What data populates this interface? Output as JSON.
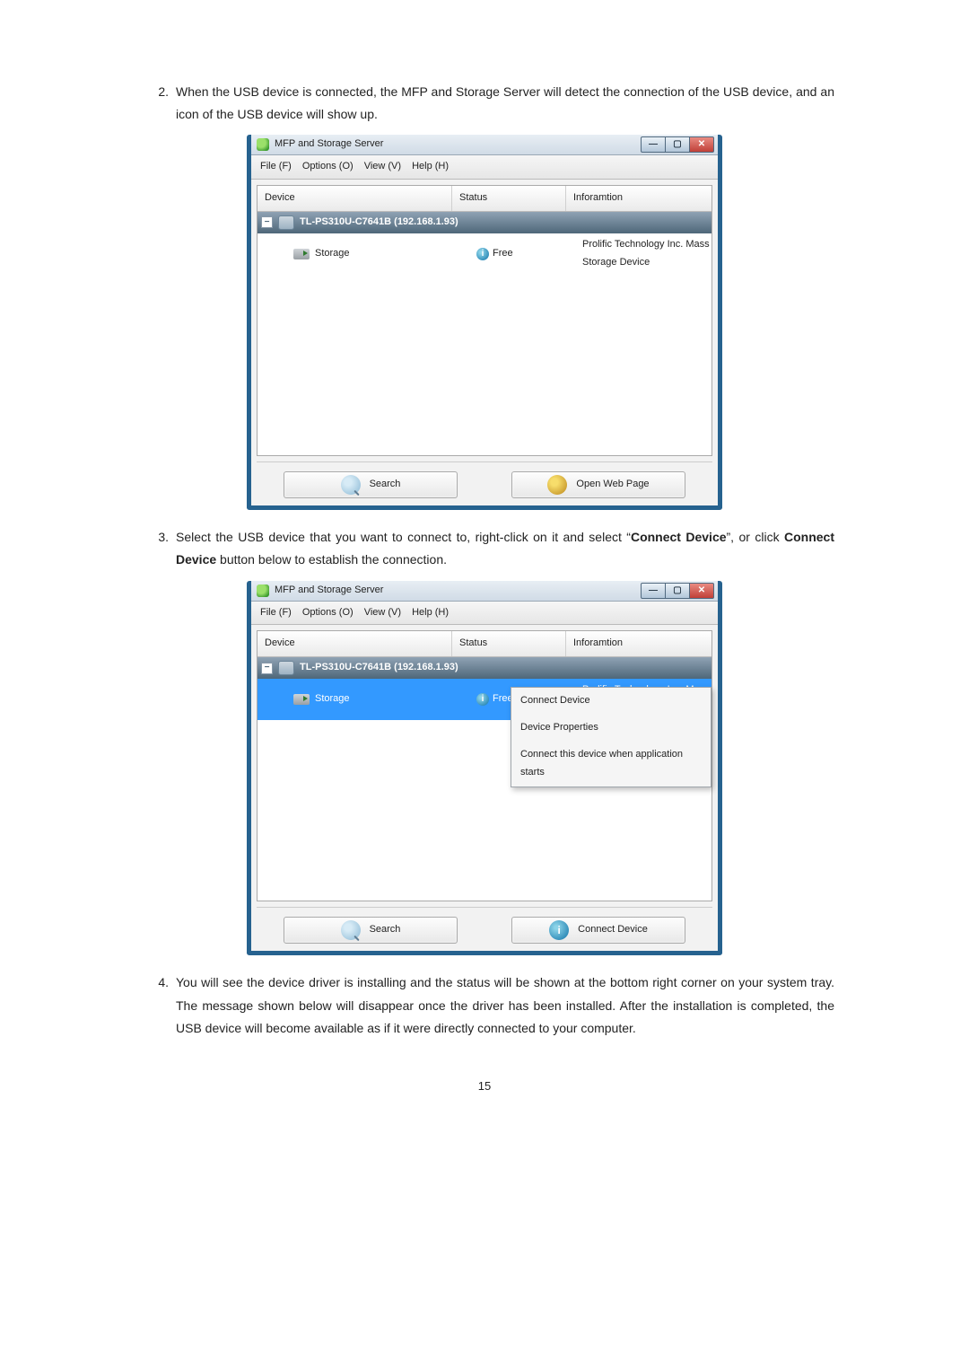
{
  "steps": {
    "s2_num": "2.",
    "s2_text_a": "When the USB device is connected, the MFP and Storage Server will detect the connection of the USB device, and an icon of the USB device will show up.",
    "s3_num": "3.",
    "s3_text_a": "Select the USB device that you want to connect to, right-click on it and select “",
    "s3_bold_a": "Connect Device",
    "s3_text_b": "”, or click ",
    "s3_bold_b": "Connect Device",
    "s3_text_c": " button below to establish the connection.",
    "s4_num": "4.",
    "s4_text_a": "You will see the device driver is installing and the status will be shown at the bottom right corner on your system tray. The message shown below will disappear once the driver has been installed. After the installation is completed, the USB device will become available as if it were directly connected to your computer."
  },
  "win_common": {
    "title": "MFP and Storage Server",
    "menu_file": "File (F)",
    "menu_options": "Options (O)",
    "menu_view": "View (V)",
    "menu_help": "Help (H)",
    "hdr_device": "Device",
    "hdr_status": "Status",
    "hdr_info": "Inforamtion",
    "server_name": "TL-PS310U-C7641B (192.168.1.93)",
    "dev_name": "Storage",
    "dev_status": "Free",
    "dev_info": "Prolific Technology Inc. Mass Storage Device",
    "btn_search": "Search",
    "tree_symbol": "−"
  },
  "win1": {
    "btn_right": "Open Web Page"
  },
  "win2": {
    "btn_right": "Connect Device",
    "ctx_connect": "Connect Device",
    "ctx_props": "Device Properties",
    "ctx_autostart": "Connect this device when application starts"
  },
  "page_number": "15"
}
